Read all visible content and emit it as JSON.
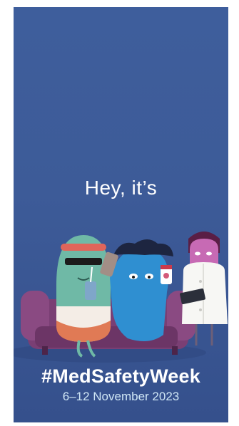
{
  "poster": {
    "headline": "Hey, it’s",
    "hashtag": "#MedSafetyWeek",
    "dates": "6–12 November 2023"
  },
  "colors": {
    "background": "#3e5e9c",
    "sofa": "#7a3f74",
    "text": "#ffffff",
    "dates_text": "#cfe6f5"
  },
  "illustration": {
    "characters": [
      "green-pill-character",
      "blue-character",
      "pharmacist-character"
    ],
    "props": [
      "sofa",
      "drink-cup",
      "phone",
      "medicine-bottle",
      "tablet"
    ]
  }
}
